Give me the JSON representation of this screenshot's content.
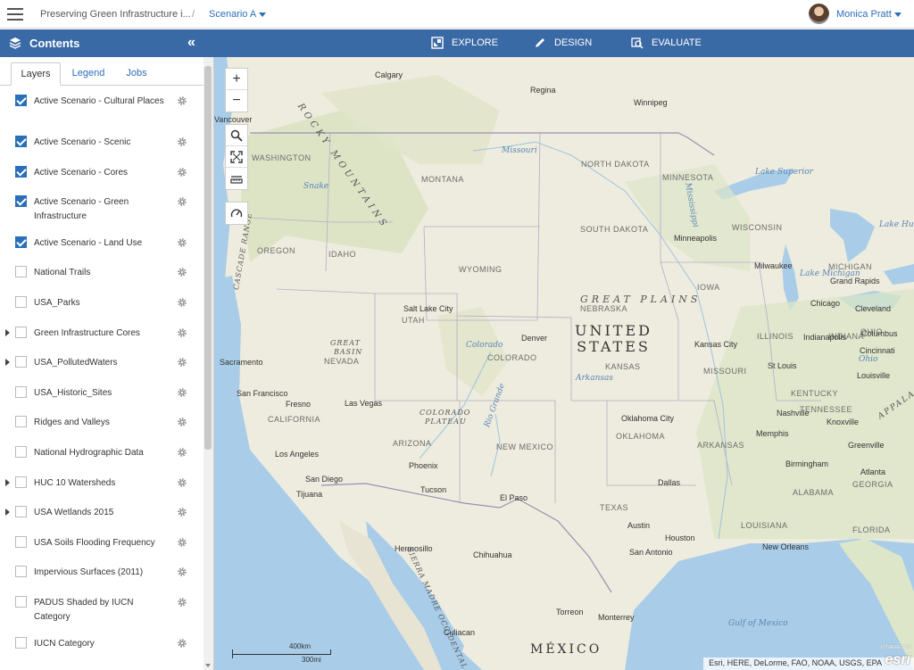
{
  "topbar": {
    "app_title": "Preserving Green Infrastructure i...",
    "separator": "/",
    "scenario": "Scenario A",
    "user_name": "Monica Pratt"
  },
  "header": {
    "contents_title": "Contents",
    "nav": [
      {
        "label": "EXPLORE",
        "icon": "explore-icon"
      },
      {
        "label": "DESIGN",
        "icon": "pencil-icon"
      },
      {
        "label": "EVALUATE",
        "icon": "evaluate-icon"
      }
    ]
  },
  "sidebar": {
    "tabs": [
      {
        "label": "Layers",
        "active": true
      },
      {
        "label": "Legend",
        "active": false
      },
      {
        "label": "Jobs",
        "active": false
      }
    ],
    "layers": [
      {
        "label": "Active Scenario - Cultural Places",
        "checked": true,
        "expandable": false
      },
      {
        "label": "Active Scenario - Scenic",
        "checked": true,
        "expandable": false
      },
      {
        "label": "Active Scenario - Cores",
        "checked": true,
        "expandable": false
      },
      {
        "label": "Active Scenario - Green Infrastructure",
        "checked": true,
        "expandable": false
      },
      {
        "label": "Active Scenario - Land Use",
        "checked": true,
        "expandable": false
      },
      {
        "label": "National Trails",
        "checked": false,
        "expandable": false
      },
      {
        "label": "USA_Parks",
        "checked": false,
        "expandable": false
      },
      {
        "label": "Green Infrastructure Cores",
        "checked": false,
        "expandable": true
      },
      {
        "label": "USA_PollutedWaters",
        "checked": false,
        "expandable": true
      },
      {
        "label": "USA_Historic_Sites",
        "checked": false,
        "expandable": false
      },
      {
        "label": "Ridges and Valleys",
        "checked": false,
        "expandable": false
      },
      {
        "label": "National Hydrographic Data",
        "checked": false,
        "expandable": false
      },
      {
        "label": "HUC 10 Watersheds",
        "checked": false,
        "expandable": true
      },
      {
        "label": "USA Wetlands 2015",
        "checked": false,
        "expandable": true
      },
      {
        "label": "USA Soils Flooding Frequency",
        "checked": false,
        "expandable": false
      },
      {
        "label": "Impervious Surfaces (2011)",
        "checked": false,
        "expandable": false
      },
      {
        "label": "PADUS Shaded by IUCN Category",
        "checked": false,
        "expandable": false
      },
      {
        "label": "IUCN Category",
        "checked": false,
        "expandable": false
      }
    ]
  },
  "map": {
    "zoom_in": "+",
    "zoom_out": "−",
    "attribution": "Esri, HERE, DeLorme, FAO, NOAA, USGS, EPA",
    "esri_logo": "esri",
    "powered_by": "POWERED BY",
    "scale_km": "400km",
    "scale_mi": "300mi",
    "country_us_line1": "UNITED",
    "country_us_line2": "STATES",
    "country_mx": "MÉXICO",
    "region_plains": "GREAT PLAINS",
    "region_rocky": "ROCKY MOUNTAINS",
    "region_basin_1": "GREAT",
    "region_basin_2": "BASIN",
    "region_plateau_1": "COLORADO",
    "region_plateau_2": "PLATEAU",
    "region_cascade": "CASCADE RANGE",
    "region_sierra": "SIERRA MADRE OCCIDENTAL",
    "region_appalachia": "APPALA",
    "states": [
      "WASHINGTON",
      "MONTANA",
      "NORTH DAKOTA",
      "MINNESOTA",
      "OREGON",
      "IDAHO",
      "WYOMING",
      "SOUTH DAKOTA",
      "WISCONSIN",
      "MICHIGAN",
      "IOWA",
      "NEBRASKA",
      "NEVADA",
      "UTAH",
      "COLORADO",
      "KANSAS",
      "ILLINOIS",
      "INDIANA",
      "OHIO",
      "MISSOURI",
      "KENTUCKY",
      "CALIFORNIA",
      "ARIZONA",
      "NEW MEXICO",
      "OKLAHOMA",
      "ARKANSAS",
      "TENNESSEE",
      "TEXAS",
      "ALABAMA",
      "GEORGIA",
      "LOUISIANA",
      "FLORIDA"
    ],
    "cities": [
      "Calgary",
      "Regina",
      "Winnipeg",
      "Vancouver",
      "Minneapolis",
      "Milwaukee",
      "Grand Rapids",
      "Chicago",
      "Cleveland",
      "Salt Lake City",
      "Denver",
      "Kansas City",
      "Indianapolis",
      "Columbus",
      "Cincinnati",
      "St Louis",
      "Louisville",
      "Sacramento",
      "San Francisco",
      "Fresno",
      "Las Vegas",
      "Los Angeles",
      "Phoenix",
      "San Diego",
      "Tijuana",
      "Tucson",
      "El Paso",
      "Oklahoma City",
      "Nashville",
      "Knoxville",
      "Memphis",
      "Greenville",
      "Birmingham",
      "Atlanta",
      "Dallas",
      "Austin",
      "Houston",
      "San Antonio",
      "New Orleans",
      "Hermosillo",
      "Chihuahua",
      "Torreon",
      "Monterrey",
      "Culiacan"
    ],
    "water": [
      "Missouri",
      "Lake Superior",
      "Snake",
      "Lake Michigan",
      "Lake Huron",
      "Colorado",
      "Arkansas",
      "Rio Grande",
      "Ohio",
      "Gulf of Mexico",
      "Mississippi"
    ]
  },
  "colors": {
    "blue_header": "#3a6aa6",
    "accent": "#2a6fb8",
    "land": "#eeecde",
    "water": "#a9cde8"
  }
}
